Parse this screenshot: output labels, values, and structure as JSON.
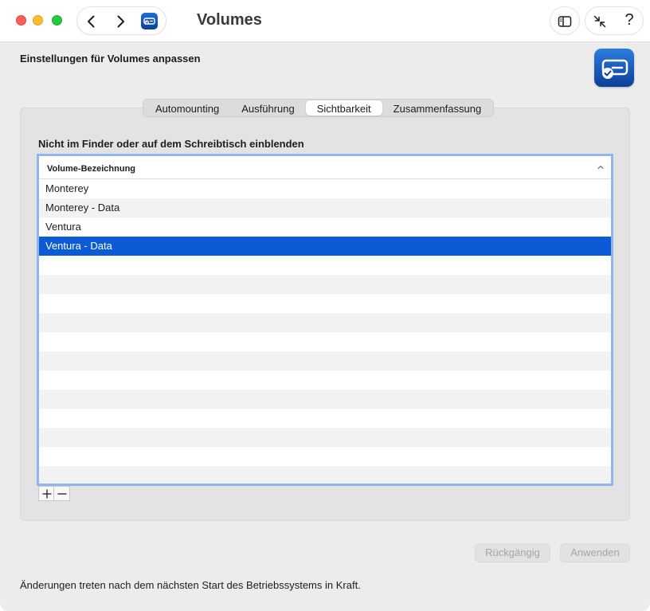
{
  "window": {
    "title": "Volumes",
    "colors": {
      "close": "#ff5f57",
      "minimize": "#febc2e",
      "maximize": "#28c840",
      "accent": "#0a5bd5"
    }
  },
  "toolbar": {
    "back_icon": "chevron-left-icon",
    "forward_icon": "chevron-right-icon",
    "app_icon": "volume-drive-icon",
    "sidebar_icon": "sidebar-toggle-icon",
    "collapse_icon": "collapse-arrows-icon",
    "help_label": "?"
  },
  "header": {
    "heading": "Einstellungen für Volumes anpassen",
    "app_icon": "volume-check-icon"
  },
  "tabs": [
    {
      "label": "Automounting",
      "active": false
    },
    {
      "label": "Ausführung",
      "active": false
    },
    {
      "label": "Sichtbarkeit",
      "active": true
    },
    {
      "label": "Zusammenfassung",
      "active": false
    }
  ],
  "section": {
    "label": "Nicht im Finder oder auf dem Schreibtisch einblenden"
  },
  "table": {
    "column_header": "Volume-Bezeichnung",
    "sort_icon": "chevron-up-icon",
    "rows": [
      {
        "name": "Monterey",
        "selected": false
      },
      {
        "name": "Monterey - Data",
        "selected": false
      },
      {
        "name": "Ventura",
        "selected": false
      },
      {
        "name": "Ventura - Data",
        "selected": true
      }
    ]
  },
  "controls": {
    "add_icon": "plus-icon",
    "remove_icon": "minus-icon",
    "undo_label": "Rückgängig",
    "apply_label": "Anwenden"
  },
  "footer": {
    "note": "Änderungen treten nach dem nächsten Start des Betriebssystems in Kraft."
  }
}
